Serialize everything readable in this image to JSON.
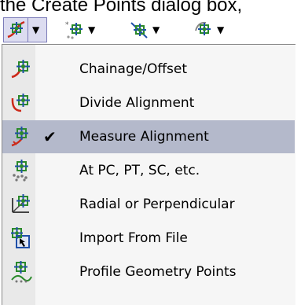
{
  "caption": "the Create Points dialog box,",
  "toolbar": {
    "buttons": [
      {
        "icon": "alignment-points-icon",
        "arrow": "▼"
      },
      {
        "icon": "miscellaneous-points-icon",
        "arrow": "▼"
      },
      {
        "icon": "intersection-points-icon",
        "arrow": "▼"
      },
      {
        "icon": "surface-points-icon",
        "arrow": "▼"
      }
    ]
  },
  "menu": {
    "items": [
      {
        "label": "Chainage/Offset",
        "icon": "chainage-offset-icon",
        "checked": false
      },
      {
        "label": "Divide Alignment",
        "icon": "divide-alignment-icon",
        "checked": false
      },
      {
        "label": "Measure Alignment",
        "icon": "measure-alignment-icon",
        "checked": true
      },
      {
        "label": "At PC, PT, SC, etc.",
        "icon": "geometry-points-icon",
        "checked": false
      },
      {
        "label": "Radial or Perpendicular",
        "icon": "radial-perpendicular-icon",
        "checked": false
      },
      {
        "label": "Import From File",
        "icon": "import-from-file-icon",
        "checked": false
      },
      {
        "label": "Profile Geometry Points",
        "icon": "profile-geometry-icon",
        "checked": false
      }
    ],
    "check_glyph": "✔"
  },
  "colors": {
    "selection": "#b4b9cb",
    "icon_red": "#cc2a1a",
    "icon_green": "#2a8a2a",
    "icon_blue": "#1f4fa8"
  }
}
